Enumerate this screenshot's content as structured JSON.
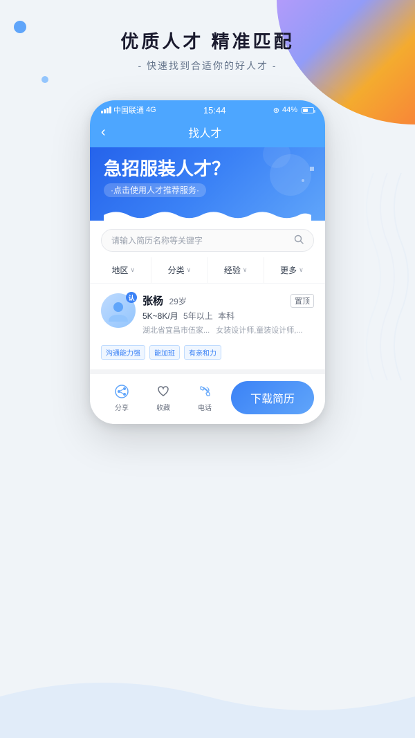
{
  "page": {
    "bg_color": "#f0f4f8"
  },
  "hero": {
    "headline": "优质人才  精准匹配",
    "subheadline": "- 快速找到合适你的好人才 -"
  },
  "phone": {
    "status_bar": {
      "carrier": "中国联通",
      "network": "4G",
      "time": "15:44",
      "battery_icon": "⊛",
      "battery_pct": "44%"
    },
    "nav": {
      "back_icon": "‹",
      "title": "找人才"
    },
    "banner": {
      "title": "急招服装人才？",
      "subtitle_btn": "·点击使用人才推荐服务·"
    },
    "search": {
      "placeholder": "请输入简历名称等关键字",
      "search_icon": "🔍"
    },
    "filters": [
      {
        "label": "地区",
        "arrow": "∨"
      },
      {
        "label": "分类",
        "arrow": "∨"
      },
      {
        "label": "经验",
        "arrow": "∨"
      },
      {
        "label": "更多",
        "arrow": "∨"
      }
    ],
    "candidate": {
      "name": "张杨",
      "age": "29岁",
      "badge": "认",
      "salary": "5K~8K/月",
      "experience": "5年以上",
      "education": "本科",
      "location": "湖北省宜昌市伍家...",
      "skills": "女装设计师,童装设计师,...",
      "tags": [
        "沟通能力强",
        "能加班",
        "有亲和力"
      ],
      "pin_label": "置顶"
    },
    "bottom_actions": {
      "share_label": "分享",
      "collect_label": "收藏",
      "phone_label": "电话",
      "download_label": "下载简历"
    }
  }
}
